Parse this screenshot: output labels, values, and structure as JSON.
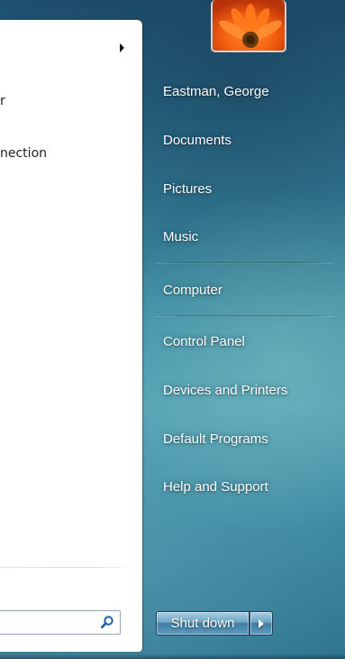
{
  "left_panel": {
    "items": [
      {
        "label": "r",
        "has_submenu": false
      },
      {
        "label": "nection",
        "has_submenu": false
      }
    ],
    "search": {
      "placeholder": "",
      "value": ""
    }
  },
  "right_panel": {
    "user_name": "Eastman, George",
    "items": [
      {
        "label": "Documents"
      },
      {
        "label": "Pictures"
      },
      {
        "label": "Music"
      },
      {
        "label": "Computer"
      },
      {
        "label": "Control Panel"
      },
      {
        "label": "Devices and Printers"
      },
      {
        "label": "Default Programs"
      },
      {
        "label": "Help and Support"
      }
    ]
  },
  "power": {
    "shutdown_label": "Shut down"
  },
  "icons": {
    "search": "search-icon",
    "submenu_arrow": "chevron-right-icon",
    "shutdown_options": "chevron-right-icon"
  },
  "colors": {
    "accent": "#2a6a86",
    "menu_text_light": "#ffffff",
    "menu_text_dark": "#1f1f1f",
    "search_icon": "#1f5fa8"
  }
}
